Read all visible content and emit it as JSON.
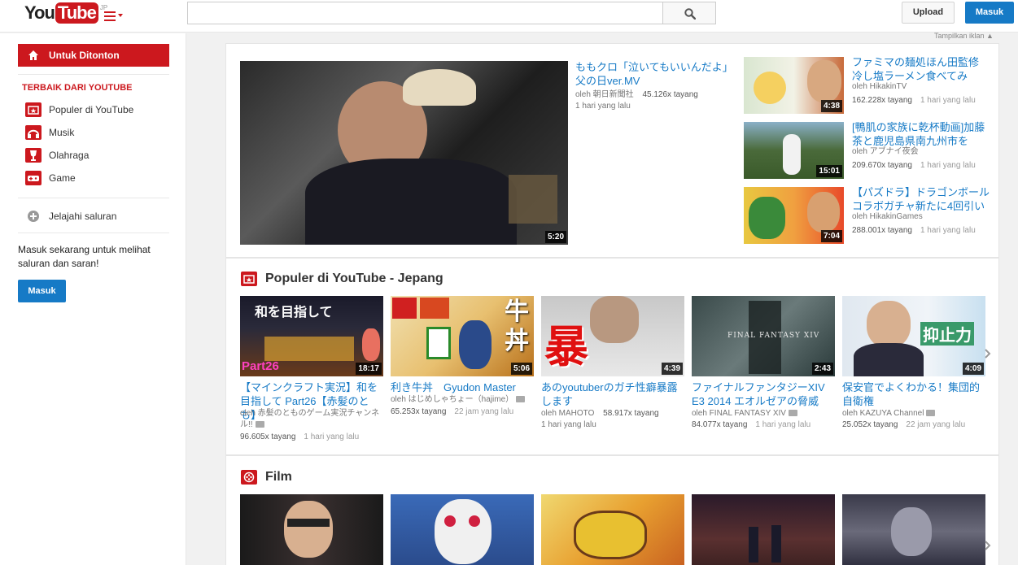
{
  "header": {
    "logo_you": "You",
    "logo_tube": "Tube",
    "logo_region": "JP",
    "search_placeholder": "",
    "upload_label": "Upload",
    "signin_label": "Masuk"
  },
  "sidebar": {
    "active_item": "Untuk Ditonton",
    "section_title": "TERBAIK DARI YOUTUBE",
    "items": [
      {
        "label": "Populer di YouTube",
        "icon": "popular-icon"
      },
      {
        "label": "Musik",
        "icon": "headphones-icon"
      },
      {
        "label": "Olahraga",
        "icon": "trophy-icon"
      },
      {
        "label": "Game",
        "icon": "gamepad-icon"
      }
    ],
    "browse_label": "Jelajahi saluran",
    "signin_prompt": "Masuk sekarang untuk melihat saluran dan saran!",
    "signin_button": "Masuk"
  },
  "ads_toggle": "Tampilkan iklan ▲",
  "featured": {
    "main": {
      "title": "ももクロ「泣いてもいいんだよ」父の日ver.MV",
      "channel": "oleh 朝日新聞社",
      "views": "45.126x tayang",
      "age": "1 hari yang lalu",
      "duration": "5:20"
    },
    "side": [
      {
        "title": "ファミマの麺処ほん田監修 冷し塩ラーメン食べてみ",
        "channel": "oleh HikakinTV",
        "views": "162.228x tayang",
        "age": "1 hari yang lalu",
        "duration": "4:38"
      },
      {
        "title": "[鴨肌の家族に乾杯動画]加藤茶と鹿児島県南九州市を",
        "channel": "oleh アブナイ夜会",
        "views": "209.670x tayang",
        "age": "1 hari yang lalu",
        "duration": "15:01"
      },
      {
        "title": "【パズドラ】ドラゴンボールコラボガチャ新たに4回引い",
        "channel": "oleh HikakinGames",
        "views": "288.001x tayang",
        "age": "1 hari yang lalu",
        "duration": "7:04"
      }
    ]
  },
  "popular": {
    "title": "Populer di YouTube - Jepang",
    "videos": [
      {
        "title": "【マインクラフト実況】和を目指して Part26【赤髪のとも】",
        "channel": "oleh 赤髪のとものゲーム実況チャンネル!!",
        "views": "96.605x tayang",
        "age": "1 hari yang lalu",
        "duration": "18:17",
        "thumb_text": "和を目指して",
        "thumb_text2": "Part26"
      },
      {
        "title": "利き牛丼　Gyudon Master",
        "channel": "oleh はじめしゃちょー（hajime）",
        "views": "65.253x tayang",
        "age": "22 jam yang lalu",
        "duration": "5:06",
        "thumb_text": "牛丼"
      },
      {
        "title": "あのyoutuberのガチ性癖暴露します",
        "channel": "oleh MAHOTO",
        "views": "58.917x tayang",
        "age": "1 hari yang lalu",
        "duration": "4:39",
        "thumb_text": "暴露"
      },
      {
        "title": "ファイナルファンタジーXIV E3 2014 エオルゼアの脅威",
        "channel": "oleh FINAL FANTASY XIV",
        "views": "84.077x tayang",
        "age": "1 hari yang lalu",
        "duration": "2:43",
        "thumb_text": "FINAL FANTASY XIV"
      },
      {
        "title": "保安官でよくわかる！集団的自衛権",
        "channel": "oleh KAZUYA Channel",
        "views": "25.052x tayang",
        "age": "22 jam yang lalu",
        "duration": "4:09",
        "thumb_text": "抑止力"
      }
    ]
  },
  "film": {
    "title": "Film"
  },
  "colors": {
    "brand_red": "#cc181e",
    "link_blue": "#167ac6",
    "signin_blue": "#167ac6"
  }
}
